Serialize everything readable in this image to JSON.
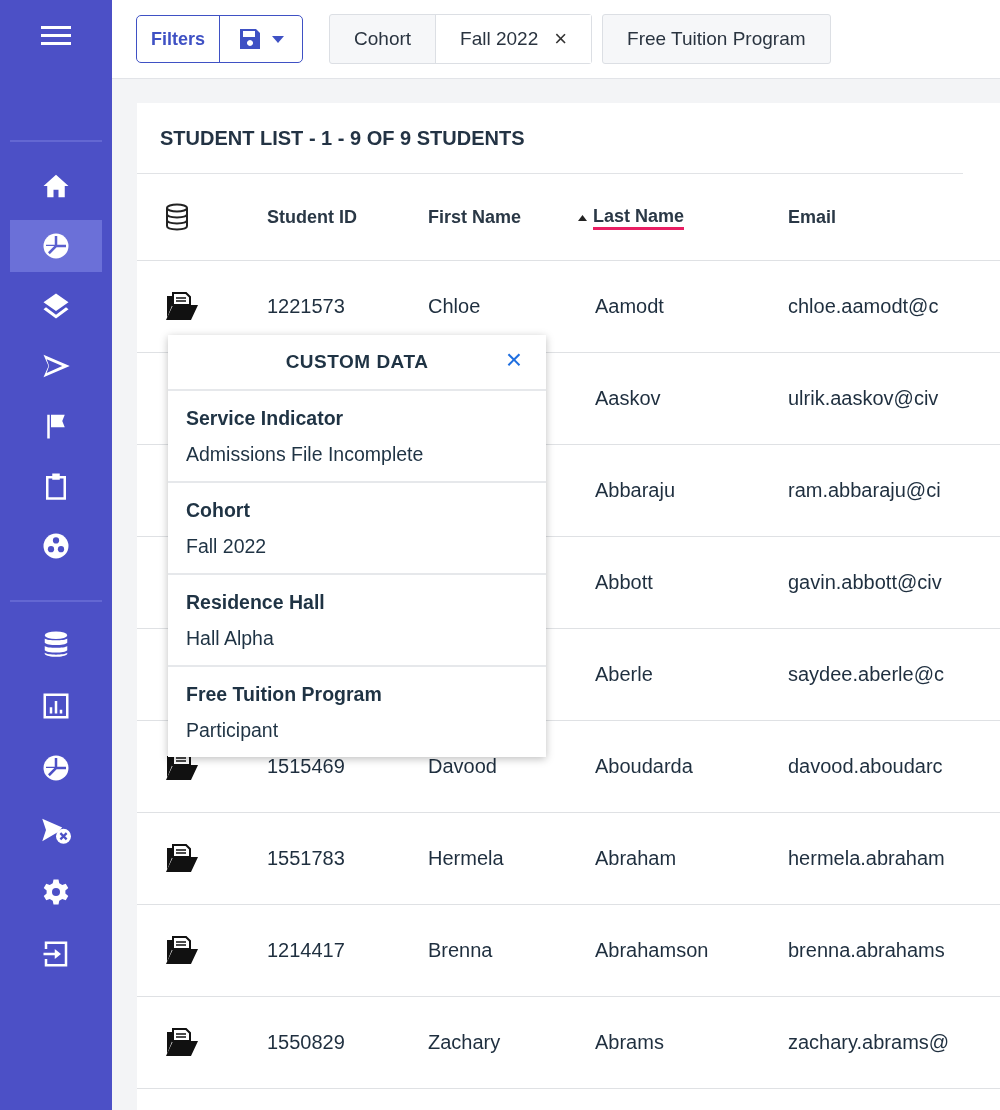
{
  "sidebar": {
    "groups": [
      {
        "items": [
          {
            "selected": false
          },
          {
            "selected": true
          },
          {
            "selected": false
          },
          {
            "selected": false
          },
          {
            "selected": false
          },
          {
            "selected": false
          },
          {
            "selected": false
          }
        ]
      },
      {
        "items": [
          {
            "selected": false
          },
          {
            "selected": false
          },
          {
            "selected": false
          },
          {
            "selected": false
          },
          {
            "selected": false
          },
          {
            "selected": false
          }
        ]
      }
    ]
  },
  "filter_bar": {
    "filters_button": "Filters",
    "chips": [
      {
        "label": "Cohort",
        "value": "Fall 2022",
        "remove": "×"
      },
      {
        "label": "Free Tuition Program"
      }
    ]
  },
  "student_list": {
    "title": "STUDENT LIST - 1 - 9 OF 9 STUDENTS",
    "columns": [
      {
        "label": "Student ID",
        "sorted": false
      },
      {
        "label": "First Name",
        "sorted": false
      },
      {
        "label": "Last Name",
        "sorted": true
      },
      {
        "label": "Email",
        "sorted": false
      }
    ],
    "rows": [
      {
        "student_id": "1221573",
        "first_name": "Chloe",
        "last_name": "Aamodt",
        "email": "chloe.aamodt@c"
      },
      {
        "last_name": "Aaskov",
        "email": "ulrik.aaskov@civ"
      },
      {
        "last_name": "Abbaraju",
        "email": "ram.abbaraju@ci"
      },
      {
        "last_name": "Abbott",
        "email": "gavin.abbott@civ"
      },
      {
        "last_name": "Aberle",
        "email": "saydee.aberle@c"
      },
      {
        "student_id": "1515469",
        "first_name": "Davood",
        "last_name": "Aboudarda",
        "email": "davood.aboudarc"
      },
      {
        "student_id": "1551783",
        "first_name": "Hermela",
        "last_name": "Abraham",
        "email": "hermela.abraham"
      },
      {
        "student_id": "1214417",
        "first_name": "Brenna",
        "last_name": "Abrahamson",
        "email": "brenna.abrahams"
      },
      {
        "student_id": "1550829",
        "first_name": "Zachary",
        "last_name": "Abrams",
        "email": "zachary.abrams@"
      }
    ]
  },
  "custom_data": {
    "title": "CUSTOM DATA",
    "close": "×",
    "fields": [
      {
        "label": "Service Indicator",
        "value": "Admissions File Incomplete"
      },
      {
        "label": "Cohort",
        "value": "Fall 2022"
      },
      {
        "label": "Residence Hall",
        "value": "Hall Alpha"
      },
      {
        "label": "Free Tuition Program",
        "value": "Participant"
      }
    ]
  }
}
